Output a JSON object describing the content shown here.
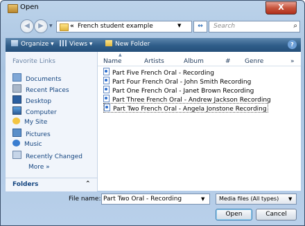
{
  "window": {
    "title": "Open",
    "close_label": "X"
  },
  "address": {
    "crumb_sep": "«",
    "crumb": "French student example",
    "search_placeholder": "Search"
  },
  "toolbar": {
    "organize": "Organize ▾",
    "views": "Views ▾",
    "new_folder": "New Folder"
  },
  "sidebar": {
    "favorites_title": "Favorite Links",
    "items": [
      {
        "label": "Documents",
        "icon": "documents-icon"
      },
      {
        "label": "Recent Places",
        "icon": "recent-places-icon"
      },
      {
        "label": "Desktop",
        "icon": "desktop-icon"
      },
      {
        "label": "Computer",
        "icon": "computer-icon"
      },
      {
        "label": "My Site",
        "icon": "my-site-icon"
      },
      {
        "label": "Pictures",
        "icon": "pictures-icon"
      },
      {
        "label": "Music",
        "icon": "music-icon"
      },
      {
        "label": "Recently Changed",
        "icon": "recently-changed-icon"
      }
    ],
    "more": "More »",
    "folders": "Folders"
  },
  "columns": [
    "Name",
    "Artists",
    "Album",
    "#",
    "Genre",
    "»"
  ],
  "files": [
    "Part Five French Oral - Recording",
    "Part Four French Oral - John Smith Recording",
    "Part One French Oral - Janet Brown Recording",
    "Part Three French Oral - Andrew Jackson Recording",
    "Part Two French Oral - Angela Jonstone Recording"
  ],
  "bottom": {
    "file_name_label": "File name:",
    "file_name_value": "Part Two Oral - Recording",
    "file_type": "Media files (All types)",
    "open": "Open",
    "cancel": "Cancel"
  },
  "colors": {
    "toolbar": "#2f5d89",
    "link": "#13447f",
    "close": "#c6553d"
  }
}
